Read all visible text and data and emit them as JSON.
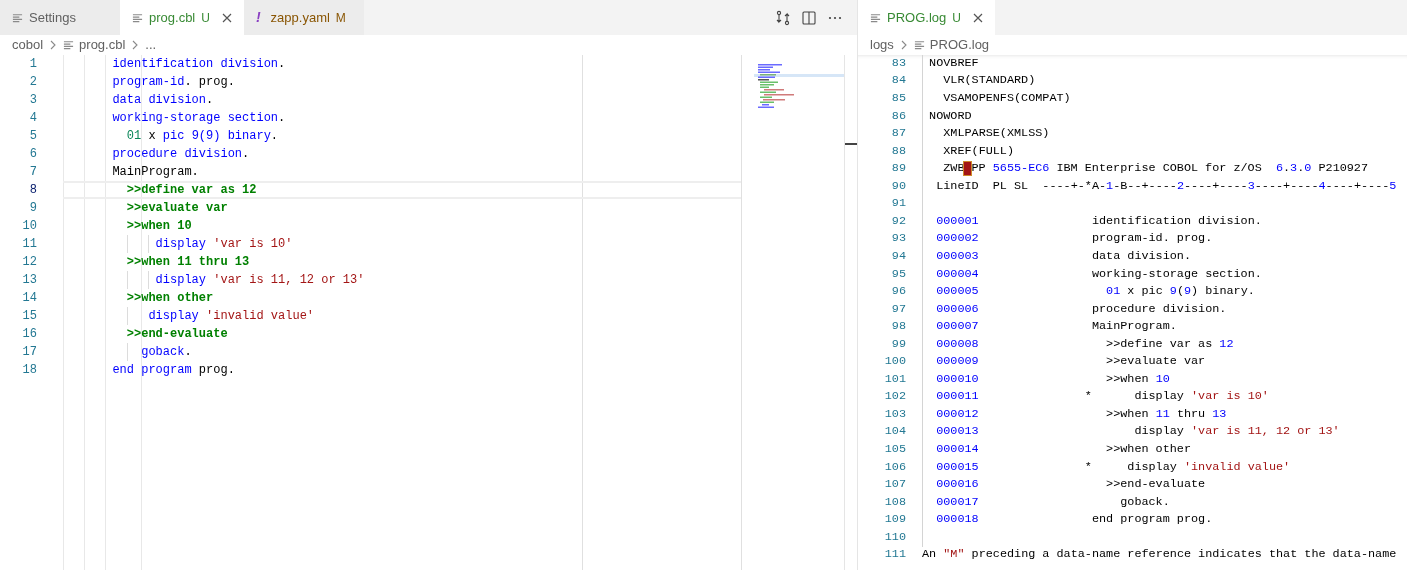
{
  "left_group": {
    "tabs": [
      {
        "label": "Settings",
        "selected": false,
        "closable": false
      },
      {
        "label": "prog.cbl",
        "badge": "U",
        "color": "#388a34",
        "selected": true,
        "closable": true
      },
      {
        "label": "zapp.yaml",
        "icon_char": "!",
        "badge": "M",
        "color": "#895503",
        "selected": false,
        "closable": false
      }
    ],
    "breadcrumbs": [
      {
        "text": "cobol"
      },
      {
        "text": "prog.cbl",
        "file": true
      },
      {
        "text": "..."
      }
    ],
    "lines": [
      {
        "number": "1",
        "current": false,
        "segments": [
          {
            "kind": "keyword",
            "text": "       identification division"
          },
          {
            "kind": "plain",
            "text": "."
          }
        ]
      },
      {
        "number": "2",
        "current": false,
        "segments": [
          {
            "kind": "keyword",
            "text": "       program-id"
          },
          {
            "kind": "plain",
            "text": ". prog."
          }
        ]
      },
      {
        "number": "3",
        "current": false,
        "segments": [
          {
            "kind": "keyword",
            "text": "       data division"
          },
          {
            "kind": "plain",
            "text": "."
          }
        ]
      },
      {
        "number": "4",
        "current": false,
        "segments": [
          {
            "kind": "keyword",
            "text": "       working-storage section"
          },
          {
            "kind": "plain",
            "text": "."
          }
        ]
      },
      {
        "number": "5",
        "current": false,
        "segments": [
          {
            "kind": "level",
            "text": "         01"
          },
          {
            "kind": "plain",
            "text": " x "
          },
          {
            "kind": "keyword",
            "text": "pic 9(9) binary"
          },
          {
            "kind": "plain",
            "text": "."
          }
        ]
      },
      {
        "number": "6",
        "current": false,
        "segments": [
          {
            "kind": "keyword",
            "text": "       procedure division"
          },
          {
            "kind": "plain",
            "text": "."
          }
        ]
      },
      {
        "number": "7",
        "current": false,
        "segments": [
          {
            "kind": "plain",
            "text": "       MainProgram."
          }
        ]
      },
      {
        "number": "8",
        "current": true,
        "segments": [
          {
            "kind": "directive",
            "text": "         >>define var as 12"
          }
        ]
      },
      {
        "number": "9",
        "current": false,
        "segments": [
          {
            "kind": "directive",
            "text": "         >>evaluate var"
          }
        ]
      },
      {
        "number": "10",
        "current": false,
        "segments": [
          {
            "kind": "directive",
            "text": "         >>when 10"
          }
        ]
      },
      {
        "number": "11",
        "current": false,
        "segments": [
          {
            "kind": "keyword",
            "text": "             display "
          },
          {
            "kind": "string",
            "text": "'var is 10'"
          }
        ]
      },
      {
        "number": "12",
        "current": false,
        "segments": [
          {
            "kind": "directive",
            "text": "         >>when 11 thru 13"
          }
        ]
      },
      {
        "number": "13",
        "current": false,
        "segments": [
          {
            "kind": "keyword",
            "text": "             display "
          },
          {
            "kind": "string",
            "text": "'var is 11, 12 or 13'"
          }
        ]
      },
      {
        "number": "14",
        "current": false,
        "segments": [
          {
            "kind": "directive",
            "text": "         >>when other"
          }
        ]
      },
      {
        "number": "15",
        "current": false,
        "segments": [
          {
            "kind": "keyword",
            "text": "            display "
          },
          {
            "kind": "string",
            "text": "'invalid value'"
          }
        ]
      },
      {
        "number": "16",
        "current": false,
        "segments": [
          {
            "kind": "directive",
            "text": "         >>end-evaluate"
          }
        ]
      },
      {
        "number": "17",
        "current": false,
        "segments": [
          {
            "kind": "keyword",
            "text": "           goback"
          },
          {
            "kind": "plain",
            "text": "."
          }
        ]
      },
      {
        "number": "18",
        "current": false,
        "segments": [
          {
            "kind": "keyword",
            "text": "       end program"
          },
          {
            "kind": "plain",
            "text": " prog."
          }
        ]
      }
    ]
  },
  "right_group": {
    "tabs": [
      {
        "label": "PROG.log",
        "badge": "U",
        "color": "#388a34",
        "selected": true,
        "closable": true
      }
    ],
    "breadcrumbs": [
      {
        "text": "logs"
      },
      {
        "text": "PROG.log",
        "file": true
      }
    ],
    "lines": [
      {
        "number": "83",
        "segments": [
          {
            "kind": "plain",
            "text": " NOVBREF"
          }
        ]
      },
      {
        "number": "84",
        "segments": [
          {
            "kind": "plain",
            "text": "   VLR(STANDARD)"
          }
        ]
      },
      {
        "number": "85",
        "segments": [
          {
            "kind": "plain",
            "text": "   VSAMOPENFS(COMPAT)"
          }
        ]
      },
      {
        "number": "86",
        "segments": [
          {
            "kind": "plain",
            "text": " NOWORD"
          }
        ]
      },
      {
        "number": "87",
        "segments": [
          {
            "kind": "plain",
            "text": "   XMLPARSE(XMLSS)"
          }
        ]
      },
      {
        "number": "88",
        "segments": [
          {
            "kind": "plain",
            "text": "   XREF(FULL)"
          }
        ]
      },
      {
        "number": "89",
        "segments": [
          {
            "kind": "plain",
            "text": "   ZWB"
          },
          {
            "kind": "control_char"
          },
          {
            "kind": "plain",
            "text": "PP "
          },
          {
            "kind": "number",
            "text": "5655-EC6"
          },
          {
            "kind": "plain",
            "text": " IBM Enterprise COBOL for z/OS  "
          },
          {
            "kind": "number",
            "text": "6"
          },
          {
            "kind": "plain",
            "text": "."
          },
          {
            "kind": "number",
            "text": "3"
          },
          {
            "kind": "plain",
            "text": "."
          },
          {
            "kind": "number",
            "text": "0"
          },
          {
            "kind": "plain",
            "text": " P210927"
          }
        ]
      },
      {
        "number": "90",
        "segments": [
          {
            "kind": "plain",
            "text": "  LineID  PL SL  ----+-*A-"
          },
          {
            "kind": "number",
            "text": "1"
          },
          {
            "kind": "plain",
            "text": "-B--+----"
          },
          {
            "kind": "number",
            "text": "2"
          },
          {
            "kind": "plain",
            "text": "----+----"
          },
          {
            "kind": "number",
            "text": "3"
          },
          {
            "kind": "plain",
            "text": "----+----"
          },
          {
            "kind": "number",
            "text": "4"
          },
          {
            "kind": "plain",
            "text": "----+----"
          },
          {
            "kind": "number",
            "text": "5"
          }
        ]
      },
      {
        "number": "91"
      },
      {
        "number": "92",
        "segments": [
          {
            "kind": "number",
            "text": "  000001"
          },
          {
            "kind": "plain",
            "text": "                identification division."
          }
        ]
      },
      {
        "number": "93",
        "segments": [
          {
            "kind": "number",
            "text": "  000002"
          },
          {
            "kind": "plain",
            "text": "                program-id. prog."
          }
        ]
      },
      {
        "number": "94",
        "segments": [
          {
            "kind": "number",
            "text": "  000003"
          },
          {
            "kind": "plain",
            "text": "                data division."
          }
        ]
      },
      {
        "number": "95",
        "segments": [
          {
            "kind": "number",
            "text": "  000004"
          },
          {
            "kind": "plain",
            "text": "                working-storage section."
          }
        ]
      },
      {
        "number": "96",
        "segments": [
          {
            "kind": "number",
            "text": "  000005"
          },
          {
            "kind": "number",
            "text": "                  01"
          },
          {
            "kind": "plain",
            "text": " x pic "
          },
          {
            "kind": "number",
            "text": "9"
          },
          {
            "kind": "plain",
            "text": "("
          },
          {
            "kind": "number",
            "text": "9"
          },
          {
            "kind": "plain",
            "text": ") binary."
          }
        ]
      },
      {
        "number": "97",
        "segments": [
          {
            "kind": "number",
            "text": "  000006"
          },
          {
            "kind": "plain",
            "text": "                procedure division."
          }
        ]
      },
      {
        "number": "98",
        "segments": [
          {
            "kind": "number",
            "text": "  000007"
          },
          {
            "kind": "plain",
            "text": "                MainProgram."
          }
        ]
      },
      {
        "number": "99",
        "segments": [
          {
            "kind": "number",
            "text": "  000008"
          },
          {
            "kind": "plain",
            "text": "                  >>define var as "
          },
          {
            "kind": "number",
            "text": "12"
          }
        ]
      },
      {
        "number": "100",
        "segments": [
          {
            "kind": "number",
            "text": "  000009"
          },
          {
            "kind": "plain",
            "text": "                  >>evaluate var"
          }
        ]
      },
      {
        "number": "101",
        "segments": [
          {
            "kind": "number",
            "text": "  000010"
          },
          {
            "kind": "plain",
            "text": "                  >>when "
          },
          {
            "kind": "number",
            "text": "10"
          }
        ]
      },
      {
        "number": "102",
        "segments": [
          {
            "kind": "number",
            "text": "  000011"
          },
          {
            "kind": "plain",
            "text": "               *      display "
          },
          {
            "kind": "string",
            "text": "'var is 10'"
          }
        ]
      },
      {
        "number": "103",
        "segments": [
          {
            "kind": "number",
            "text": "  000012"
          },
          {
            "kind": "plain",
            "text": "                  >>when "
          },
          {
            "kind": "number",
            "text": "11"
          },
          {
            "kind": "plain",
            "text": " thru "
          },
          {
            "kind": "number",
            "text": "13"
          }
        ]
      },
      {
        "number": "104",
        "segments": [
          {
            "kind": "number",
            "text": "  000013"
          },
          {
            "kind": "plain",
            "text": "                      display "
          },
          {
            "kind": "string",
            "text": "'var is 11, 12 or 13'"
          }
        ]
      },
      {
        "number": "105",
        "segments": [
          {
            "kind": "number",
            "text": "  000014"
          },
          {
            "kind": "plain",
            "text": "                  >>when other"
          }
        ]
      },
      {
        "number": "106",
        "segments": [
          {
            "kind": "number",
            "text": "  000015"
          },
          {
            "kind": "plain",
            "text": "               *     display "
          },
          {
            "kind": "string",
            "text": "'invalid value'"
          }
        ]
      },
      {
        "number": "107",
        "segments": [
          {
            "kind": "number",
            "text": "  000016"
          },
          {
            "kind": "plain",
            "text": "                  >>end-evaluate"
          }
        ]
      },
      {
        "number": "108",
        "segments": [
          {
            "kind": "number",
            "text": "  000017"
          },
          {
            "kind": "plain",
            "text": "                    goback."
          }
        ]
      },
      {
        "number": "109",
        "segments": [
          {
            "kind": "number",
            "text": "  000018"
          },
          {
            "kind": "plain",
            "text": "                end program prog."
          }
        ]
      },
      {
        "number": "110"
      },
      {
        "number": "111",
        "segments": [
          {
            "kind": "plain",
            "text": "An "
          },
          {
            "kind": "string",
            "text": "\"M\""
          },
          {
            "kind": "plain",
            "text": " preceding a data-name reference indicates that the data-name"
          }
        ]
      }
    ]
  }
}
